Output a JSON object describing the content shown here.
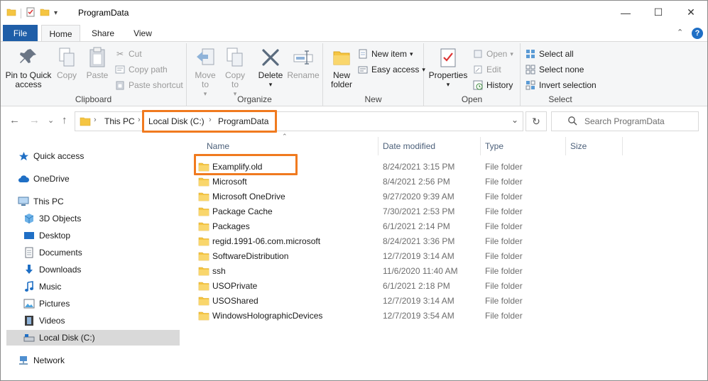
{
  "window": {
    "title": "ProgramData",
    "minimize_glyph": "—",
    "maximize_glyph": "☐",
    "close_glyph": "✕"
  },
  "ribbon_tabs": {
    "file": "File",
    "home": "Home",
    "share": "Share",
    "view": "View"
  },
  "help_glyph": "?",
  "collapse_glyph": "⌃",
  "ribbon": {
    "clipboard": {
      "label": "Clipboard",
      "pin": "Pin to Quick access",
      "copy": "Copy",
      "paste": "Paste",
      "cut": "Cut",
      "copy_path": "Copy path",
      "paste_shortcut": "Paste shortcut"
    },
    "organize": {
      "label": "Organize",
      "move_to": "Move to",
      "copy_to": "Copy to",
      "delete": "Delete",
      "rename": "Rename"
    },
    "new": {
      "label": "New",
      "new_folder": "New folder",
      "new_item": "New item",
      "easy_access": "Easy access"
    },
    "open": {
      "label": "Open",
      "properties": "Properties",
      "open": "Open",
      "edit": "Edit",
      "history": "History"
    },
    "select": {
      "label": "Select",
      "select_all": "Select all",
      "select_none": "Select none",
      "invert_selection": "Invert selection"
    }
  },
  "address": {
    "crumbs": [
      "This PC",
      "Local Disk (C:)",
      "ProgramData"
    ],
    "separator": "›",
    "dropdown_glyph": "⌄",
    "refresh_glyph": "↻",
    "search_placeholder": "Search ProgramData"
  },
  "nav_buttons": {
    "back": "←",
    "forward": "→",
    "recent": "⌄",
    "up": "↑"
  },
  "nav_pane": [
    {
      "label": "Quick access",
      "icon": "star-icon"
    },
    {
      "label": "OneDrive",
      "icon": "cloud-icon"
    },
    {
      "label": "This PC",
      "icon": "computer-icon"
    },
    {
      "label": "3D Objects",
      "icon": "cube-icon"
    },
    {
      "label": "Desktop",
      "icon": "desktop-icon"
    },
    {
      "label": "Documents",
      "icon": "document-icon"
    },
    {
      "label": "Downloads",
      "icon": "download-icon"
    },
    {
      "label": "Music",
      "icon": "music-icon"
    },
    {
      "label": "Pictures",
      "icon": "picture-icon"
    },
    {
      "label": "Videos",
      "icon": "video-icon"
    },
    {
      "label": "Local Disk (C:)",
      "icon": "drive-icon",
      "selected": true
    },
    {
      "label": "Network",
      "icon": "network-icon"
    }
  ],
  "columns": {
    "name": "Name",
    "date": "Date modified",
    "type": "Type",
    "size": "Size"
  },
  "files": [
    {
      "name": "Examplify.old",
      "date": "8/24/2021 3:15 PM",
      "type": "File folder"
    },
    {
      "name": "Microsoft",
      "date": "8/4/2021 2:56 PM",
      "type": "File folder"
    },
    {
      "name": "Microsoft OneDrive",
      "date": "9/27/2020 9:39 AM",
      "type": "File folder"
    },
    {
      "name": "Package Cache",
      "date": "7/30/2021 2:53 PM",
      "type": "File folder"
    },
    {
      "name": "Packages",
      "date": "6/1/2021 2:14 PM",
      "type": "File folder"
    },
    {
      "name": "regid.1991-06.com.microsoft",
      "date": "8/24/2021 3:36 PM",
      "type": "File folder"
    },
    {
      "name": "SoftwareDistribution",
      "date": "12/7/2019 3:14 AM",
      "type": "File folder"
    },
    {
      "name": "ssh",
      "date": "11/6/2020 11:40 AM",
      "type": "File folder"
    },
    {
      "name": "USOPrivate",
      "date": "6/1/2021 2:18 PM",
      "type": "File folder"
    },
    {
      "name": "USOShared",
      "date": "12/7/2019 3:14 AM",
      "type": "File folder"
    },
    {
      "name": "WindowsHolographicDevices",
      "date": "12/7/2019 3:54 AM",
      "type": "File folder"
    }
  ],
  "colors": {
    "accent": "#1f5ea8",
    "highlight": "#f07a1f",
    "folder": "#f5c542"
  }
}
